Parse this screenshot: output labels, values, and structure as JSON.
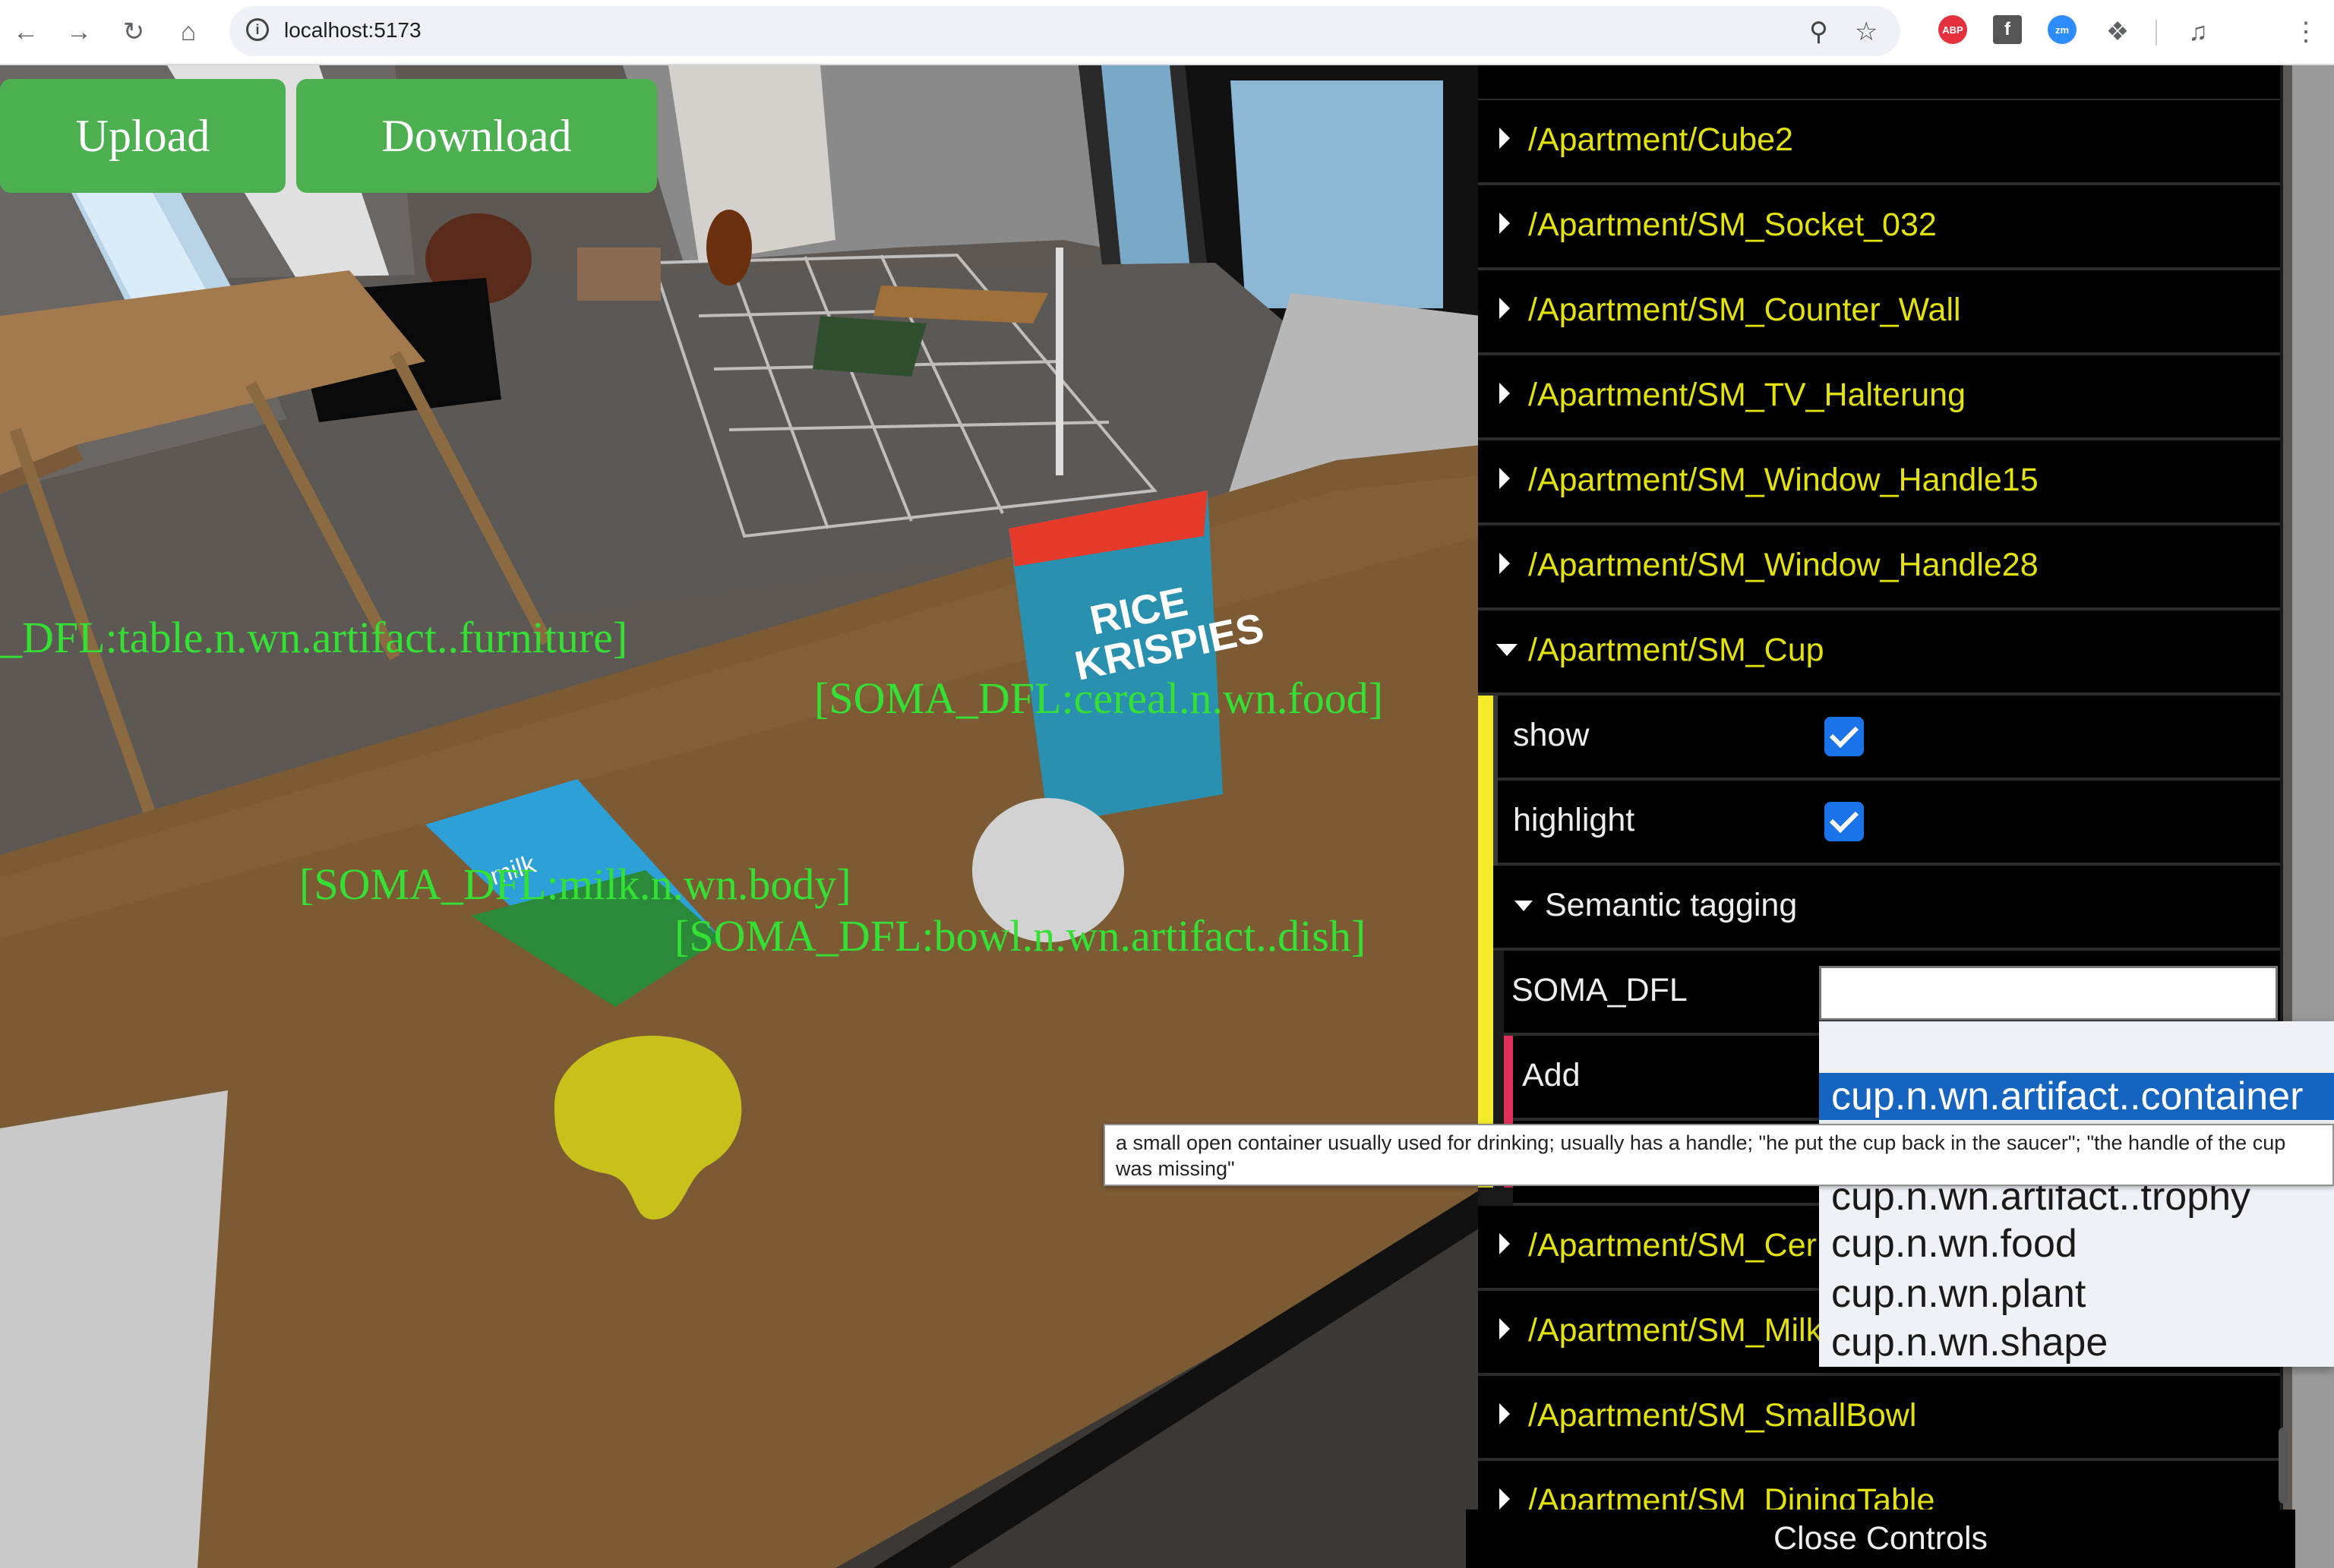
{
  "browser": {
    "url": "localhost:5173",
    "extensions": [
      {
        "name": "adblock-plus-icon",
        "label": "ABP",
        "color": "#e5303e"
      },
      {
        "name": "facebook-icon",
        "label": "f",
        "color": "#555"
      },
      {
        "name": "zoom-icon",
        "label": "zm",
        "color": "#2d8cff"
      }
    ]
  },
  "toolbar": {
    "upload_label": "Upload",
    "download_label": "Download"
  },
  "scene_labels": [
    "_DFL:table.n.wn.artifact..furniture]",
    "[SOMA_DFL:cereal.n.wn.food]",
    "[SOMA_DFL:milk.n.wn.body]",
    "[SOMA_DFL:bowl.n.wn.artifact..dish]"
  ],
  "cereal_box_text": [
    "RICE",
    "KRISPIES"
  ],
  "milk_box_text": "milk",
  "panel": {
    "top_folders": [
      "/Apartment/Cube2",
      "/Apartment/SM_Socket_032",
      "/Apartment/SM_Counter_Wall",
      "/Apartment/SM_TV_Halterung",
      "/Apartment/SM_Window_Handle15",
      "/Apartment/SM_Window_Handle28"
    ],
    "open_folder": "/Apartment/SM_Cup",
    "show_label": "show",
    "show_checked": true,
    "highlight_label": "highlight",
    "highlight_checked": true,
    "semantic_folder": "Semantic tagging",
    "soma_label": "SOMA_DFL",
    "soma_value": "",
    "add_label": "Add",
    "bottom_folders": [
      "/Apartment/SM_Cer",
      "/Apartment/SM_Milk",
      "/Apartment/SM_SmallBowl",
      "/Apartment/SM_DiningTable"
    ],
    "close_label": "Close Controls"
  },
  "autocomplete": {
    "options": [
      "cup.n.wn.artifact..container",
      "cup.n.wn.artifact..trophy",
      "cup.n.wn.food",
      "cup.n.wn.plant",
      "cup.n.wn.shape"
    ],
    "selected_index": 0,
    "tooltip": "a small open container usually used for drinking; usually has a handle; \"he put the cup back in the saucer\"; \"the handle of the cup was missing\""
  },
  "colors": {
    "folder_text": "#e3e30b",
    "label_green": "#35e035",
    "button_green": "#4caf50",
    "checkbox_blue": "#1a73e8",
    "option_selected": "#1565c0"
  }
}
